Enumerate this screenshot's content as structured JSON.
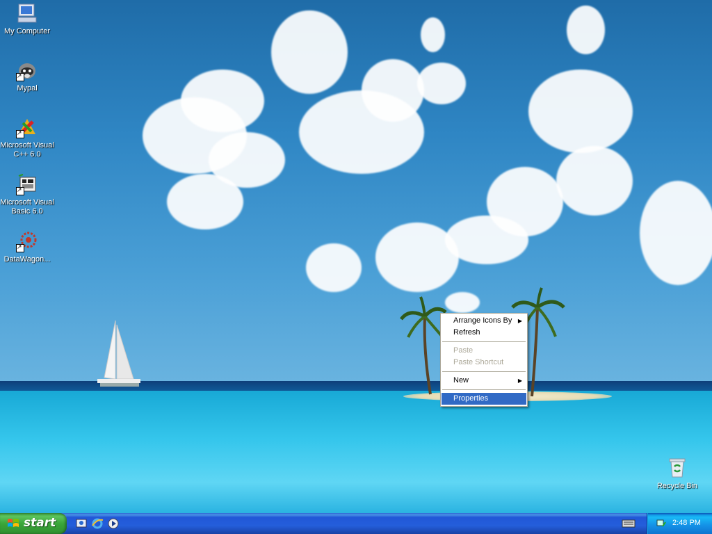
{
  "desktop": {
    "icons": [
      {
        "label": "My Computer",
        "icon": "my-computer-icon"
      },
      {
        "label": "Mypal",
        "icon": "mypal-raccoon-icon"
      },
      {
        "label": "Microsoft Visual C++ 6.0",
        "icon": "visual-cpp-icon"
      },
      {
        "label": "Microsoft Visual Basic 6.0",
        "icon": "visual-basic-icon"
      },
      {
        "label": "DataWagon...",
        "icon": "datawagon-icon"
      },
      {
        "label": "Recycle Bin",
        "icon": "recycle-bin-icon"
      }
    ]
  },
  "context_menu": {
    "items": [
      {
        "label": "Arrange Icons By",
        "submenu": true,
        "enabled": true
      },
      {
        "label": "Refresh",
        "enabled": true
      },
      {
        "label": "Paste",
        "enabled": false
      },
      {
        "label": "Paste Shortcut",
        "enabled": false
      },
      {
        "label": "New",
        "submenu": true,
        "enabled": true
      },
      {
        "label": "Properties",
        "enabled": true,
        "selected": true
      }
    ],
    "selection_color": "#316ac5"
  },
  "taskbar": {
    "start_label": "start",
    "quick_launch": [
      "show-desktop-icon",
      "internet-explorer-icon",
      "media-player-icon"
    ],
    "language_icon": "keyboard-icon",
    "tray_icon": "network-tray-icon",
    "clock": "2:48 PM"
  }
}
